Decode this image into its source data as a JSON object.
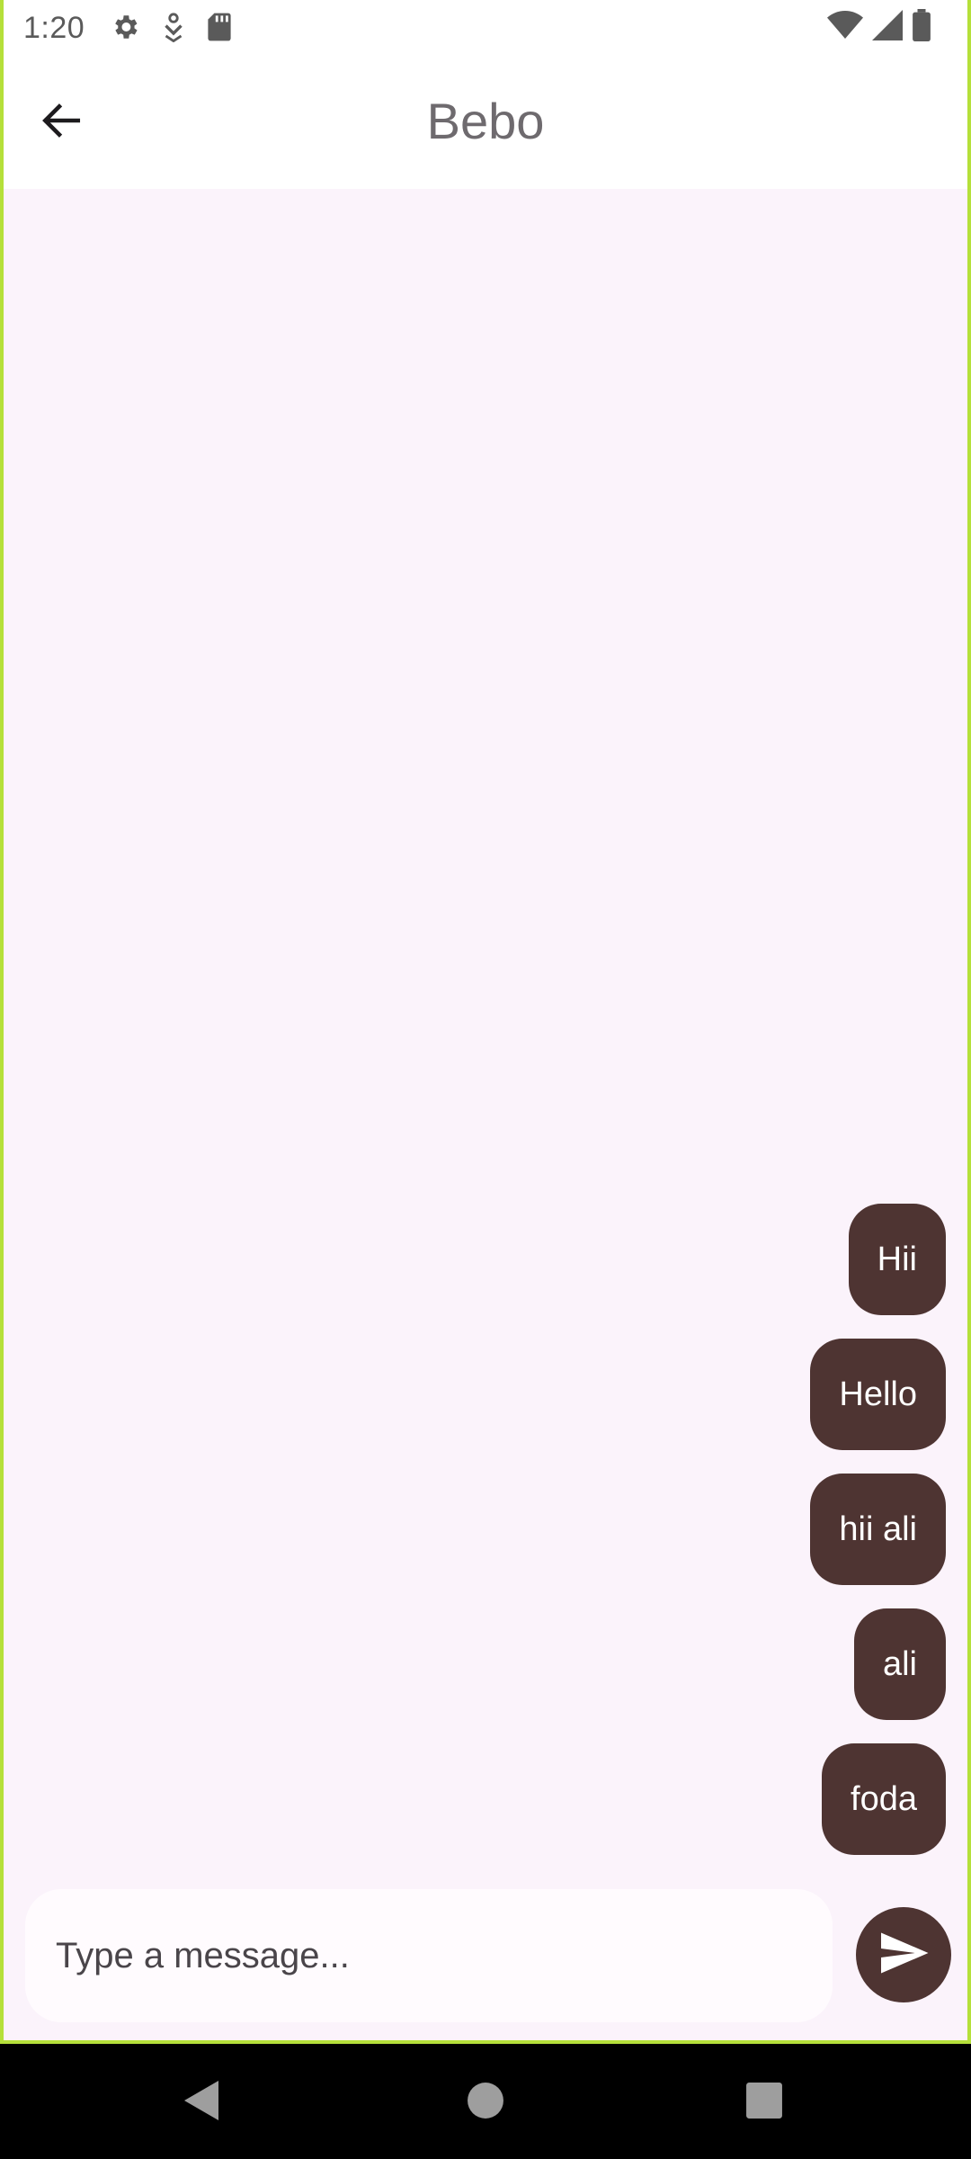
{
  "status_bar": {
    "time": "1:20",
    "left_icons": [
      "settings-icon",
      "download-icon",
      "sd-card-icon"
    ],
    "right_icons": [
      "wifi-icon",
      "cell-signal-icon",
      "battery-icon"
    ]
  },
  "app_bar": {
    "title": "Bebo",
    "back_icon": "arrow-left-icon"
  },
  "messages": [
    {
      "text": "Hii"
    },
    {
      "text": "Hello"
    },
    {
      "text": "hii ali"
    },
    {
      "text": "ali"
    },
    {
      "text": "foda"
    }
  ],
  "composer": {
    "placeholder": "Type a message...",
    "value": "",
    "send_icon": "send-icon"
  },
  "nav_bar": {
    "buttons": [
      "back-triangle-icon",
      "home-circle-icon",
      "recents-square-icon"
    ]
  },
  "colors": {
    "background": "#FBF3FB",
    "bubble": "#4E3432",
    "bubble_text": "#FFFFFF",
    "frame_accent": "#B5E03A",
    "title": "#6E6A6E"
  }
}
